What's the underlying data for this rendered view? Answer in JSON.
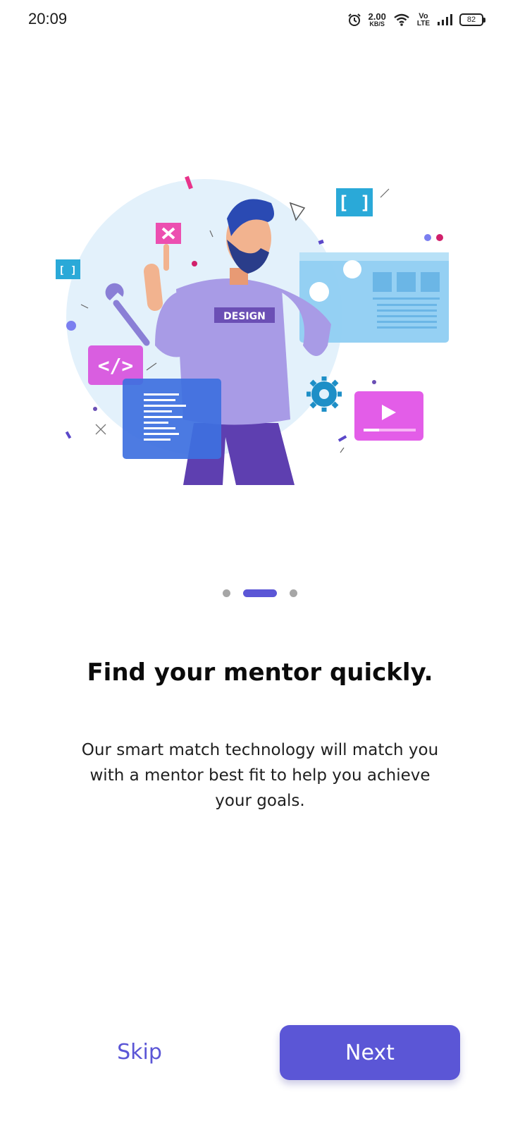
{
  "status_bar": {
    "time": "20:09",
    "net_speed_value": "2.00",
    "net_speed_unit": "KB/S",
    "volte_top": "Vo",
    "volte_bottom": "LTE",
    "battery": "82",
    "icons": [
      "alarm-icon",
      "wifi-icon",
      "signal-icon",
      "battery-icon"
    ]
  },
  "illustration": {
    "shirt_text": "DESIGN",
    "bracket_text": "[ ]",
    "code_text": "</>"
  },
  "pager": {
    "total": 3,
    "active_index": 1
  },
  "onboarding": {
    "title": "Find your mentor quickly.",
    "description": "Our smart match technology will match you with a mentor best fit to help you achieve your goals."
  },
  "actions": {
    "skip_label": "Skip",
    "next_label": "Next"
  },
  "colors": {
    "accent": "#5b56d6",
    "background": "#ffffff",
    "dot_inactive": "#a6a6a6"
  }
}
